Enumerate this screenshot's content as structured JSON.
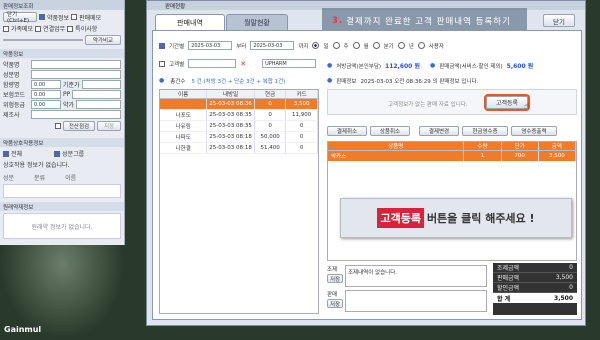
{
  "left": {
    "title": "판매정보조회",
    "row1": [
      "닫기(Ctrl+E)",
      "약품정보",
      "판매메모"
    ],
    "row2": [
      "가족메모",
      "연결업무",
      "특이사항"
    ],
    "bottom_btn": "약가비교",
    "sec_drug": "약품정보",
    "fields": [
      "약품명",
      "성분명",
      "함량명",
      "보험코드",
      "위험등급",
      "제조사"
    ],
    "vals": [
      "0.00",
      "0.00",
      "0.00"
    ],
    "sub": [
      "기준가",
      "PP",
      "약가"
    ],
    "btn_check": "전산점검",
    "btn_save": "저장",
    "sec_interact": "약품상호작용정보",
    "interact_cols": [
      "성분",
      "분류",
      "이름"
    ],
    "interact_checks": [
      "전체",
      "성분그룹"
    ],
    "interact_empty": "상호작용 정보가 없습니다.",
    "sec_memo": "원래약재정보",
    "memo_empty": "원래약 정보가 없습니다.",
    "logo": "Gainmul"
  },
  "window": {
    "title": "판매현황",
    "tabs": [
      "판매내역",
      "월말현황"
    ],
    "close": "닫기",
    "banner_num": "3.",
    "banner_text": "결제까지 완료한 고객 판매내역 등록하기"
  },
  "filters": {
    "period_label": "기간별",
    "date_from": "2025-03-03",
    "date_to": "2025-03-03",
    "to_word": "부터",
    "until_word": "까지",
    "radios": [
      "일",
      "주",
      "월",
      "분기",
      "년",
      "사용자"
    ],
    "customer_label": "고객별",
    "store": "UPHARM"
  },
  "summary_top": {
    "count_label": "총건수",
    "count_text": "5 건 (처방 3건 + 단순 3건 + 복합 1건)",
    "claim_label": "처방금액(본인부담)",
    "claim_value": "112,600 원",
    "sale_label": "판매금액(서비스·할인 제외)",
    "sale_value": "5,600 원",
    "info_label": "판매정보",
    "info_text": "2025-03-03 오전 08:36:29 의 판매정보 입니다."
  },
  "table": {
    "headers": [
      "이름",
      "내방일",
      "현금",
      "카드"
    ],
    "rows": [
      [
        "",
        "25-03-03 08:36",
        "0",
        "3,500"
      ],
      [
        "나포도",
        "25-03-03 08:35",
        "0",
        "11,900"
      ],
      [
        "나유림",
        "25-03-03 08:35",
        "0",
        "0"
      ],
      [
        "나파도",
        "25-03-03 08:18",
        "50,000",
        "0"
      ],
      [
        "나한결",
        "25-03-03 08:18",
        "51,400",
        "0"
      ]
    ]
  },
  "customer_notice": "고객정보가 없는 판매 자료 입니다.",
  "register_btn": "고객등록",
  "actions": [
    "결제취소",
    "상품취소",
    "결제변경",
    "현금영수증",
    "영수증출력"
  ],
  "items": {
    "headers": [
      "상품명",
      "수량",
      "단가",
      "금액"
    ],
    "rows": [
      [
        "박카스",
        "1",
        "700",
        "3,500"
      ]
    ]
  },
  "callout": {
    "tag": "고객등록",
    "text": "버튼을 클릭 해주세요 !"
  },
  "memo": {
    "sell_label": "조제",
    "save": "저장",
    "sell_text": "조제내역이 없습니다.",
    "item_label": "판매",
    "save2": "저장"
  },
  "totals": [
    [
      "조제금액",
      "0"
    ],
    [
      "판매금액",
      "3,500"
    ],
    [
      "할인금액",
      "0"
    ],
    [
      "합    계",
      "3,500"
    ]
  ]
}
